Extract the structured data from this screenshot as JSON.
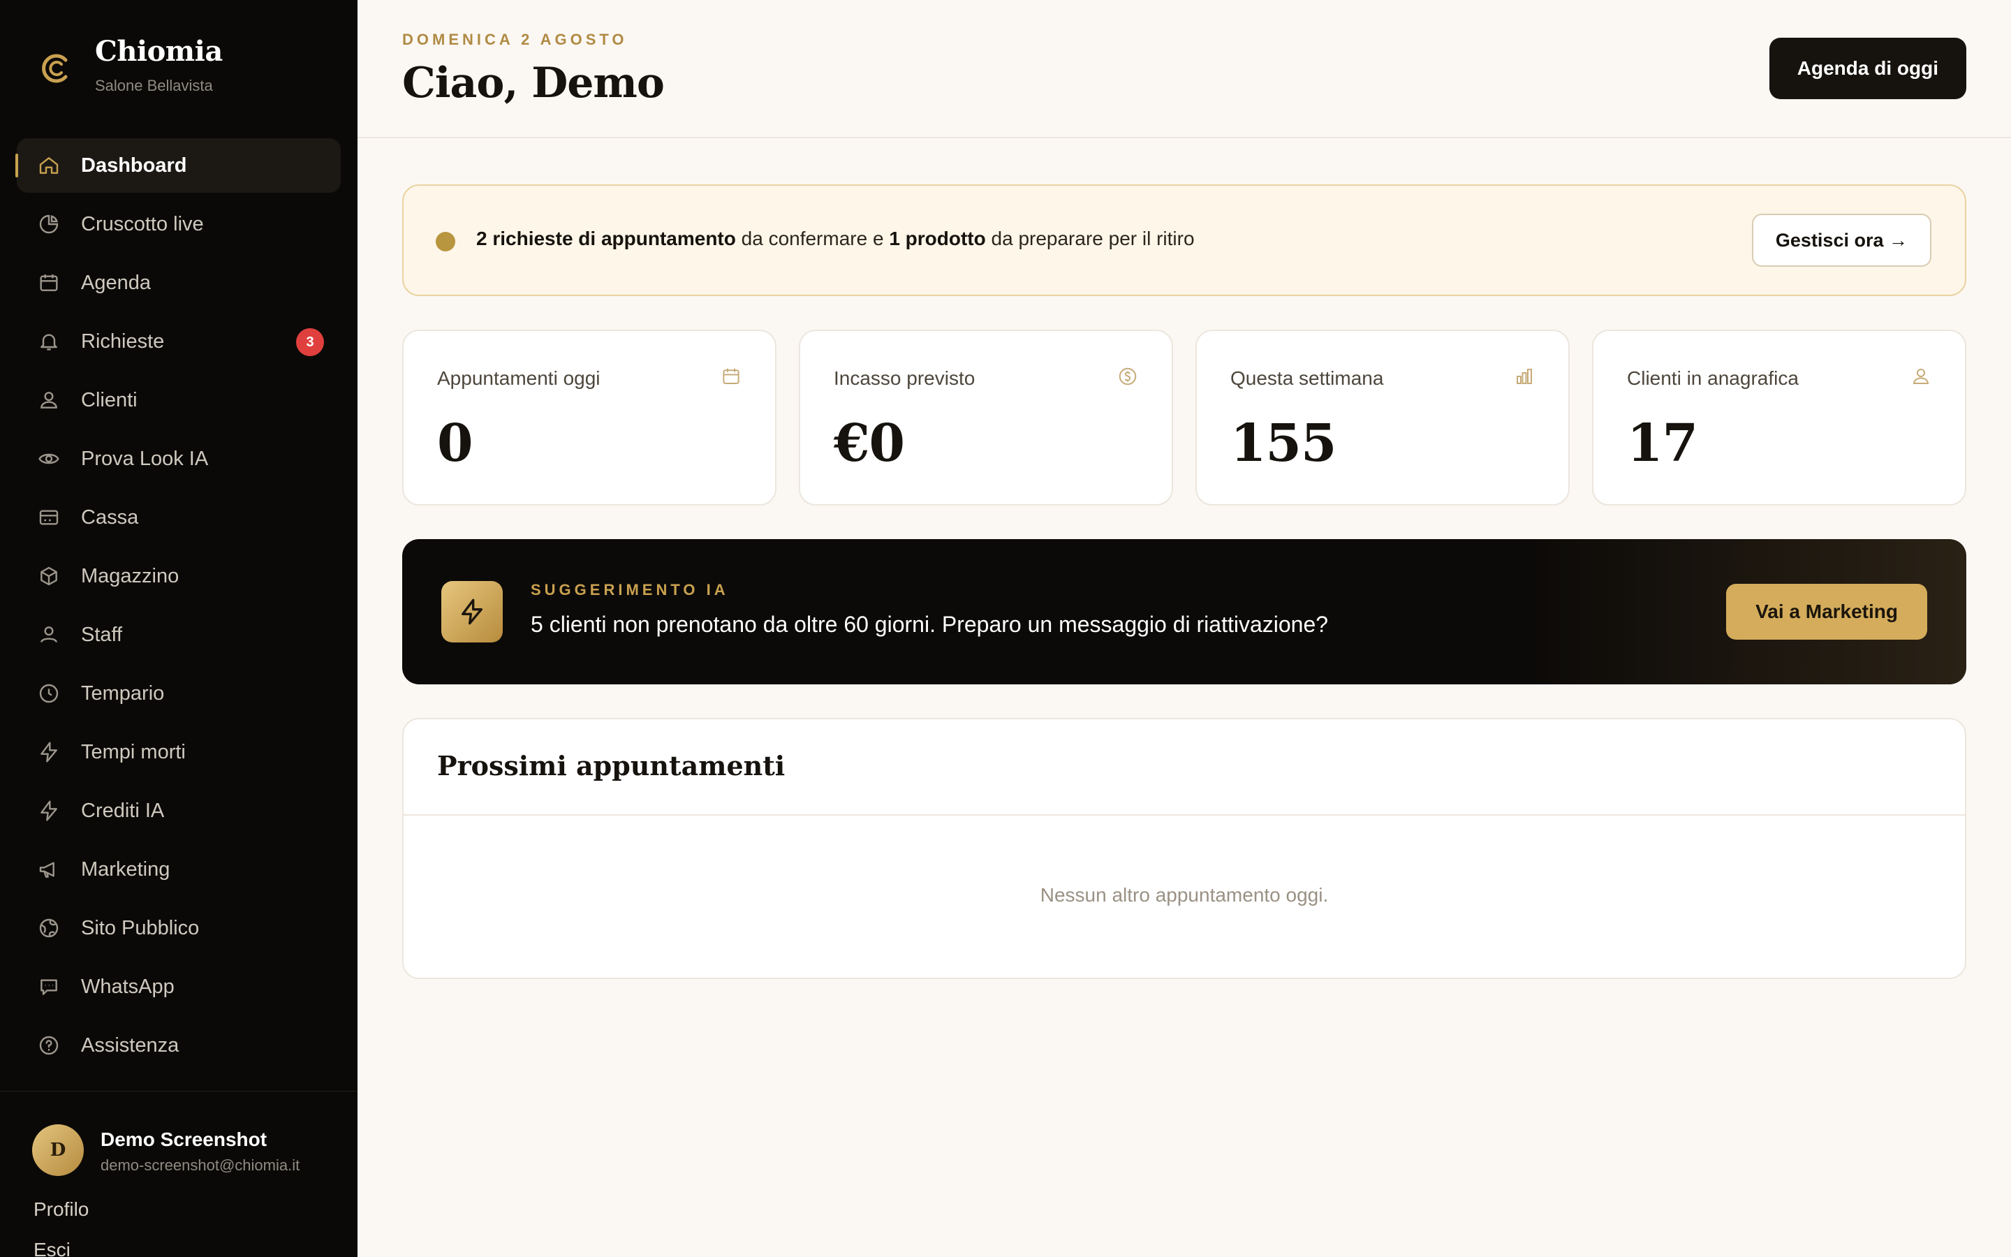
{
  "brand": {
    "name": "Chiomia",
    "subtitle": "Salone Bellavista"
  },
  "sidebar": {
    "items": [
      {
        "label": "Dashboard",
        "icon": "home-icon",
        "active": true
      },
      {
        "label": "Cruscotto live",
        "icon": "pie-chart-icon"
      },
      {
        "label": "Agenda",
        "icon": "calendar-icon"
      },
      {
        "label": "Richieste",
        "icon": "bell-icon",
        "badge": "3"
      },
      {
        "label": "Clienti",
        "icon": "user-icon"
      },
      {
        "label": "Prova Look IA",
        "icon": "eye-icon"
      },
      {
        "label": "Cassa",
        "icon": "register-icon"
      },
      {
        "label": "Magazzino",
        "icon": "box-icon"
      },
      {
        "label": "Staff",
        "icon": "users-icon"
      },
      {
        "label": "Tempario",
        "icon": "clock-icon"
      },
      {
        "label": "Tempi morti",
        "icon": "bolt-icon"
      },
      {
        "label": "Crediti IA",
        "icon": "bolt-icon"
      },
      {
        "label": "Marketing",
        "icon": "megaphone-icon"
      },
      {
        "label": "Sito Pubblico",
        "icon": "globe-icon"
      },
      {
        "label": "WhatsApp",
        "icon": "chat-icon"
      },
      {
        "label": "Assistenza",
        "icon": "help-icon"
      }
    ]
  },
  "user": {
    "initial": "D",
    "name": "Demo Screenshot",
    "email": "demo-screenshot@chiomia.it"
  },
  "links": {
    "profile": "Profilo",
    "logout": "Esci"
  },
  "header": {
    "date": "DOMENICA 2 AGOSTO",
    "greeting": "Ciao, Demo",
    "agenda_button": "Agenda di oggi"
  },
  "notice": {
    "part1_bold": "2 richieste di appuntamento",
    "part2": " da confermare e ",
    "part3_bold": "1 prodotto",
    "part4": " da preparare per il ritiro",
    "button": "Gestisci ora →"
  },
  "stats": [
    {
      "label": "Appuntamenti oggi",
      "value": "0",
      "icon": "calendar-icon"
    },
    {
      "label": "Incasso previsto",
      "value": "€0",
      "icon": "coin-icon"
    },
    {
      "label": "Questa settimana",
      "value": "155",
      "icon": "bar-chart-icon"
    },
    {
      "label": "Clienti in anagrafica",
      "value": "17",
      "icon": "user-icon"
    }
  ],
  "ai": {
    "kicker": "SUGGERIMENTO IA",
    "text": "5 clienti non prenotano da oltre 60 giorni. Preparo un messaggio di riattivazione?",
    "button": "Vai a Marketing",
    "icon": "bolt-icon"
  },
  "upcoming": {
    "title": "Prossimi appuntamenti",
    "empty": "Nessun altro appuntamento oggi."
  },
  "colors": {
    "accent": "#c9a150",
    "sidebar_bg": "#0b0907",
    "page_bg": "#fbf8f4",
    "badge": "#e0403d"
  }
}
